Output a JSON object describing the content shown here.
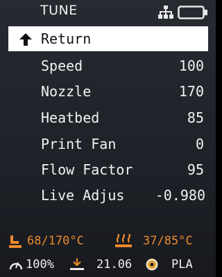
{
  "header": {
    "title": "TUNE",
    "network_icon": "network-icon",
    "sd_icon": "sd-card-icon"
  },
  "menu": {
    "items": [
      {
        "label": "Return",
        "value": "",
        "icon": "back-arrow-icon",
        "selected": true
      },
      {
        "label": "Speed",
        "value": "100"
      },
      {
        "label": "Nozzle",
        "value": "170"
      },
      {
        "label": "Heatbed",
        "value": "85"
      },
      {
        "label": "Print Fan",
        "value": "0"
      },
      {
        "label": "Flow Factor",
        "value": "95"
      },
      {
        "label": "Live Adjus",
        "value": "-0.980"
      }
    ]
  },
  "status": {
    "nozzle_temp": "68/170°C",
    "bed_temp": "37/85°C",
    "speed": "100%",
    "z_height": "21.06",
    "filament": "PLA"
  },
  "colors": {
    "accent": "#ee8a2c",
    "text": "#f2f2f2",
    "selected_bg": "#ffffff",
    "background": "#1e2228"
  }
}
